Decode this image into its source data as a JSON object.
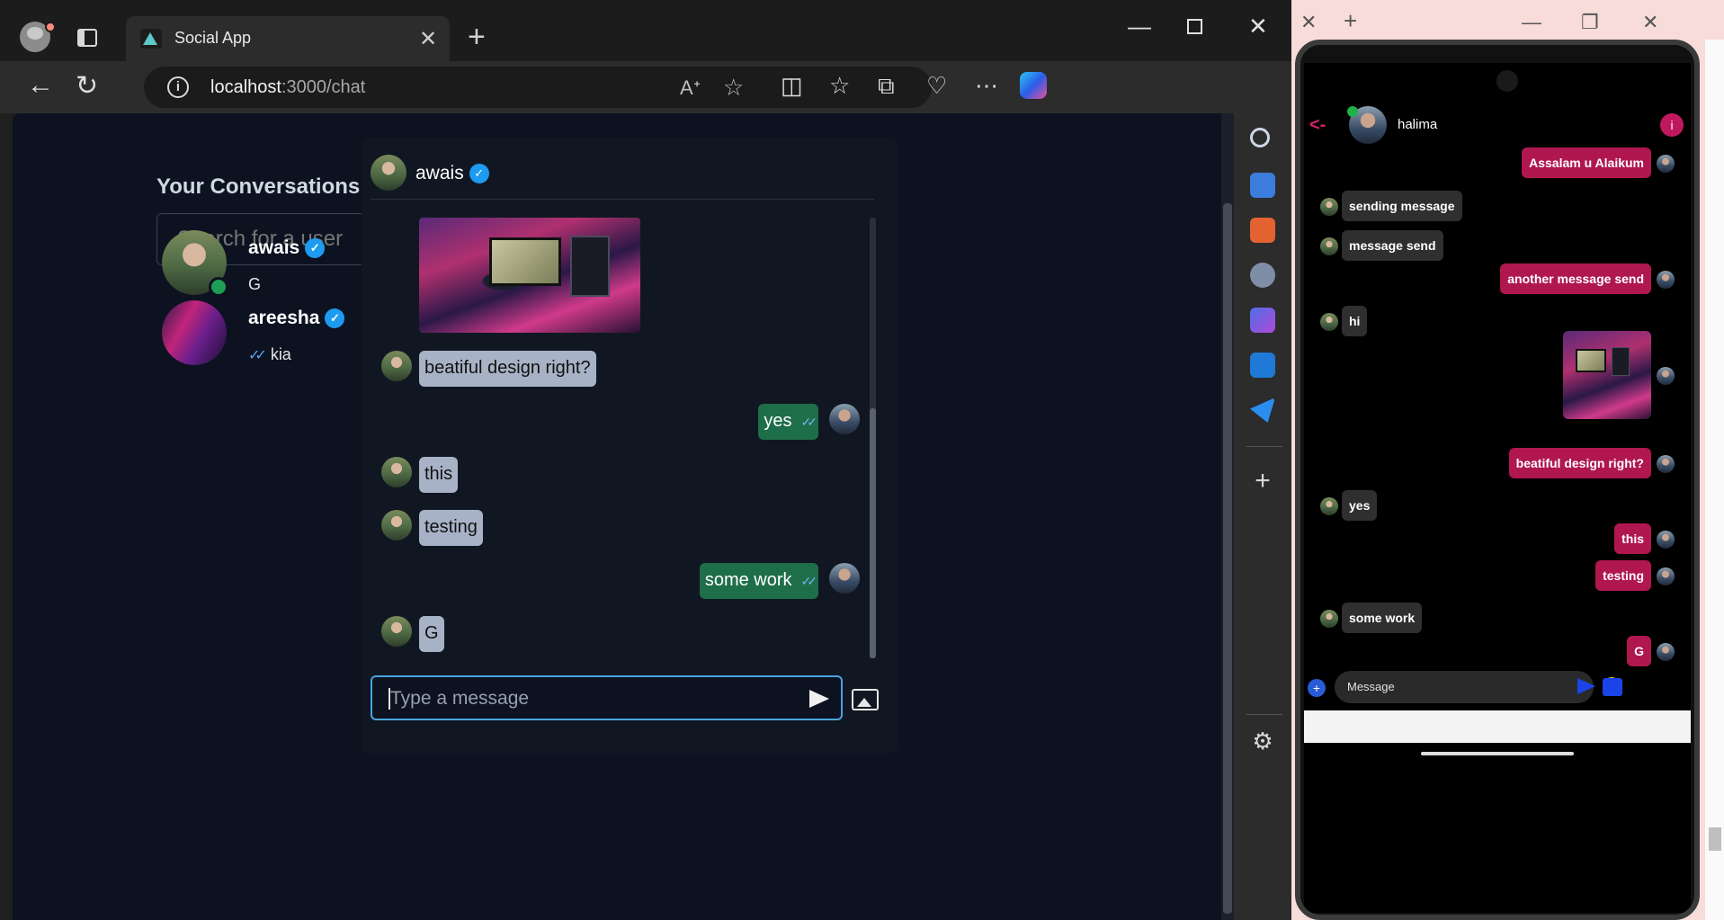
{
  "browser": {
    "tab_title": "Social App",
    "url_host": "localhost",
    "url_path": ":3000/chat"
  },
  "sidebar": {
    "title": "Your Conversations",
    "search_placeholder": "Search for a user",
    "conversations": [
      {
        "name": "awais",
        "last_message": "G",
        "online": true,
        "verified": true
      },
      {
        "name": "areesha",
        "last_message": "kia",
        "online": false,
        "verified": true
      }
    ]
  },
  "chat": {
    "partner_name": "awais",
    "messages": [
      {
        "type": "image",
        "direction": "in"
      },
      {
        "type": "text",
        "direction": "in",
        "text": "beatiful design right?"
      },
      {
        "type": "text",
        "direction": "out",
        "text": "yes",
        "seen": true
      },
      {
        "type": "text",
        "direction": "in",
        "text": "this"
      },
      {
        "type": "text",
        "direction": "in",
        "text": "testing"
      },
      {
        "type": "text",
        "direction": "out",
        "text": "some work",
        "seen": true
      },
      {
        "type": "text",
        "direction": "in",
        "text": "G"
      }
    ],
    "composer_placeholder": "Type a message"
  },
  "phone": {
    "header_name": "halima",
    "back_label": "<-",
    "info_label": "i",
    "messages": [
      {
        "direction": "out",
        "text": "Assalam u Alaikum"
      },
      {
        "direction": "in",
        "text": "sending message"
      },
      {
        "direction": "in",
        "text": "message send"
      },
      {
        "direction": "out",
        "text": "another message send"
      },
      {
        "direction": "in",
        "text": "hi"
      },
      {
        "direction": "out",
        "type": "image"
      },
      {
        "direction": "out",
        "text": "beatiful design right?"
      },
      {
        "direction": "in",
        "text": "yes"
      },
      {
        "direction": "out",
        "text": "this"
      },
      {
        "direction": "out",
        "text": "testing"
      },
      {
        "direction": "in",
        "text": "some work"
      },
      {
        "direction": "out",
        "text": "G"
      }
    ],
    "input_placeholder": "Message",
    "plus_label": "+"
  },
  "icons": {
    "check": "✓",
    "double_tick": "✓✓"
  },
  "colors": {
    "page_bg": "#0c1220",
    "bubble_in": "#a7b2c6",
    "bubble_out": "#1f6e4a",
    "verified": "#1d9bf0",
    "phone_out": "#b0174f",
    "phone_in": "#2f2f2f"
  }
}
